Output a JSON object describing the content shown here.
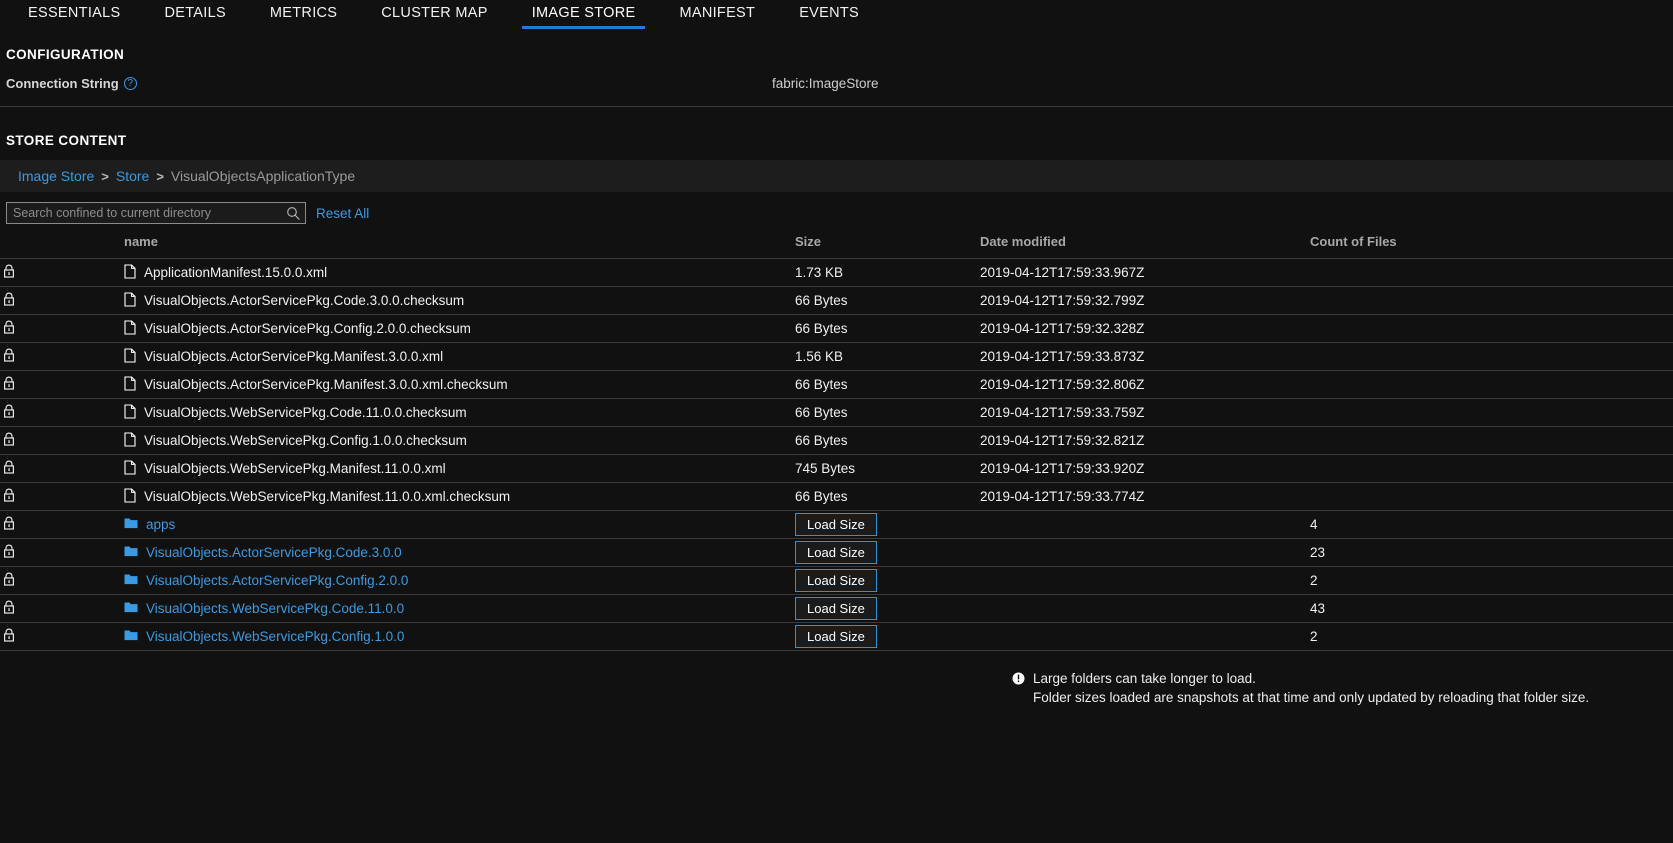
{
  "tabs": [
    {
      "label": "ESSENTIALS",
      "active": false
    },
    {
      "label": "DETAILS",
      "active": false
    },
    {
      "label": "METRICS",
      "active": false
    },
    {
      "label": "CLUSTER MAP",
      "active": false
    },
    {
      "label": "IMAGE STORE",
      "active": true
    },
    {
      "label": "MANIFEST",
      "active": false
    },
    {
      "label": "EVENTS",
      "active": false
    }
  ],
  "configuration": {
    "section_title": "CONFIGURATION",
    "connection_string_label": "Connection String",
    "help_icon": "question-mark-icon",
    "connection_string_value": "fabric:ImageStore"
  },
  "store_content": {
    "section_title": "STORE CONTENT",
    "breadcrumb": {
      "items": [
        {
          "label": "Image Store",
          "link": true
        },
        {
          "label": "Store",
          "link": true
        },
        {
          "label": "VisualObjectsApplicationType",
          "link": false
        }
      ],
      "separator": ">"
    },
    "toolbar": {
      "search_placeholder": "Search confined to current directory",
      "search_value": "",
      "search_icon": "magnifier-icon",
      "reset_all_label": "Reset All"
    },
    "columns": {
      "lock": "",
      "name": "name",
      "size": "Size",
      "date_modified": "Date modified",
      "count_of_files": "Count of Files"
    },
    "load_size_label": "Load Size",
    "rows": [
      {
        "lock_icon": "lock-icon",
        "type": "file",
        "icon": "file-icon",
        "name": "ApplicationManifest.15.0.0.xml",
        "size": "1.73 KB",
        "date_modified": "2019-04-12T17:59:33.967Z",
        "count": ""
      },
      {
        "lock_icon": "lock-icon",
        "type": "file",
        "icon": "file-icon",
        "name": "VisualObjects.ActorServicePkg.Code.3.0.0.checksum",
        "size": "66 Bytes",
        "date_modified": "2019-04-12T17:59:32.799Z",
        "count": ""
      },
      {
        "lock_icon": "lock-icon",
        "type": "file",
        "icon": "file-icon",
        "name": "VisualObjects.ActorServicePkg.Config.2.0.0.checksum",
        "size": "66 Bytes",
        "date_modified": "2019-04-12T17:59:32.328Z",
        "count": ""
      },
      {
        "lock_icon": "lock-icon",
        "type": "file",
        "icon": "file-icon",
        "name": "VisualObjects.ActorServicePkg.Manifest.3.0.0.xml",
        "size": "1.56 KB",
        "date_modified": "2019-04-12T17:59:33.873Z",
        "count": ""
      },
      {
        "lock_icon": "lock-icon",
        "type": "file",
        "icon": "file-icon",
        "name": "VisualObjects.ActorServicePkg.Manifest.3.0.0.xml.checksum",
        "size": "66 Bytes",
        "date_modified": "2019-04-12T17:59:32.806Z",
        "count": ""
      },
      {
        "lock_icon": "lock-icon",
        "type": "file",
        "icon": "file-icon",
        "name": "VisualObjects.WebServicePkg.Code.11.0.0.checksum",
        "size": "66 Bytes",
        "date_modified": "2019-04-12T17:59:33.759Z",
        "count": ""
      },
      {
        "lock_icon": "lock-icon",
        "type": "file",
        "icon": "file-icon",
        "name": "VisualObjects.WebServicePkg.Config.1.0.0.checksum",
        "size": "66 Bytes",
        "date_modified": "2019-04-12T17:59:32.821Z",
        "count": ""
      },
      {
        "lock_icon": "lock-icon",
        "type": "file",
        "icon": "file-icon",
        "name": "VisualObjects.WebServicePkg.Manifest.11.0.0.xml",
        "size": "745 Bytes",
        "date_modified": "2019-04-12T17:59:33.920Z",
        "count": ""
      },
      {
        "lock_icon": "lock-icon",
        "type": "file",
        "icon": "file-icon",
        "name": "VisualObjects.WebServicePkg.Manifest.11.0.0.xml.checksum",
        "size": "66 Bytes",
        "date_modified": "2019-04-12T17:59:33.774Z",
        "count": ""
      },
      {
        "lock_icon": "lock-icon",
        "type": "folder",
        "icon": "folder-icon",
        "name": "apps",
        "size": "",
        "date_modified": "",
        "count": "4"
      },
      {
        "lock_icon": "lock-icon",
        "type": "folder",
        "icon": "folder-icon",
        "name": "VisualObjects.ActorServicePkg.Code.3.0.0",
        "size": "",
        "date_modified": "",
        "count": "23"
      },
      {
        "lock_icon": "lock-icon",
        "type": "folder",
        "icon": "folder-icon",
        "name": "VisualObjects.ActorServicePkg.Config.2.0.0",
        "size": "",
        "date_modified": "",
        "count": "2"
      },
      {
        "lock_icon": "lock-icon",
        "type": "folder",
        "icon": "folder-icon",
        "name": "VisualObjects.WebServicePkg.Code.11.0.0",
        "size": "",
        "date_modified": "",
        "count": "43"
      },
      {
        "lock_icon": "lock-icon",
        "type": "folder",
        "icon": "folder-icon",
        "name": "VisualObjects.WebServicePkg.Config.1.0.0",
        "size": "",
        "date_modified": "",
        "count": "2"
      }
    ],
    "footnote": {
      "icon": "info-exclamation-icon",
      "line1": "Large folders can take longer to load.",
      "line2": "Folder sizes loaded are snapshots at that time and only updated by reloading that folder size."
    }
  },
  "colors": {
    "background": "#111111",
    "accent_blue": "#1a7fd4",
    "link_blue": "#3b9ae1",
    "row_border": "#3a3a3a",
    "breadcrumb_bg": "#1d1d1d",
    "muted_text": "#9a9a9a"
  }
}
